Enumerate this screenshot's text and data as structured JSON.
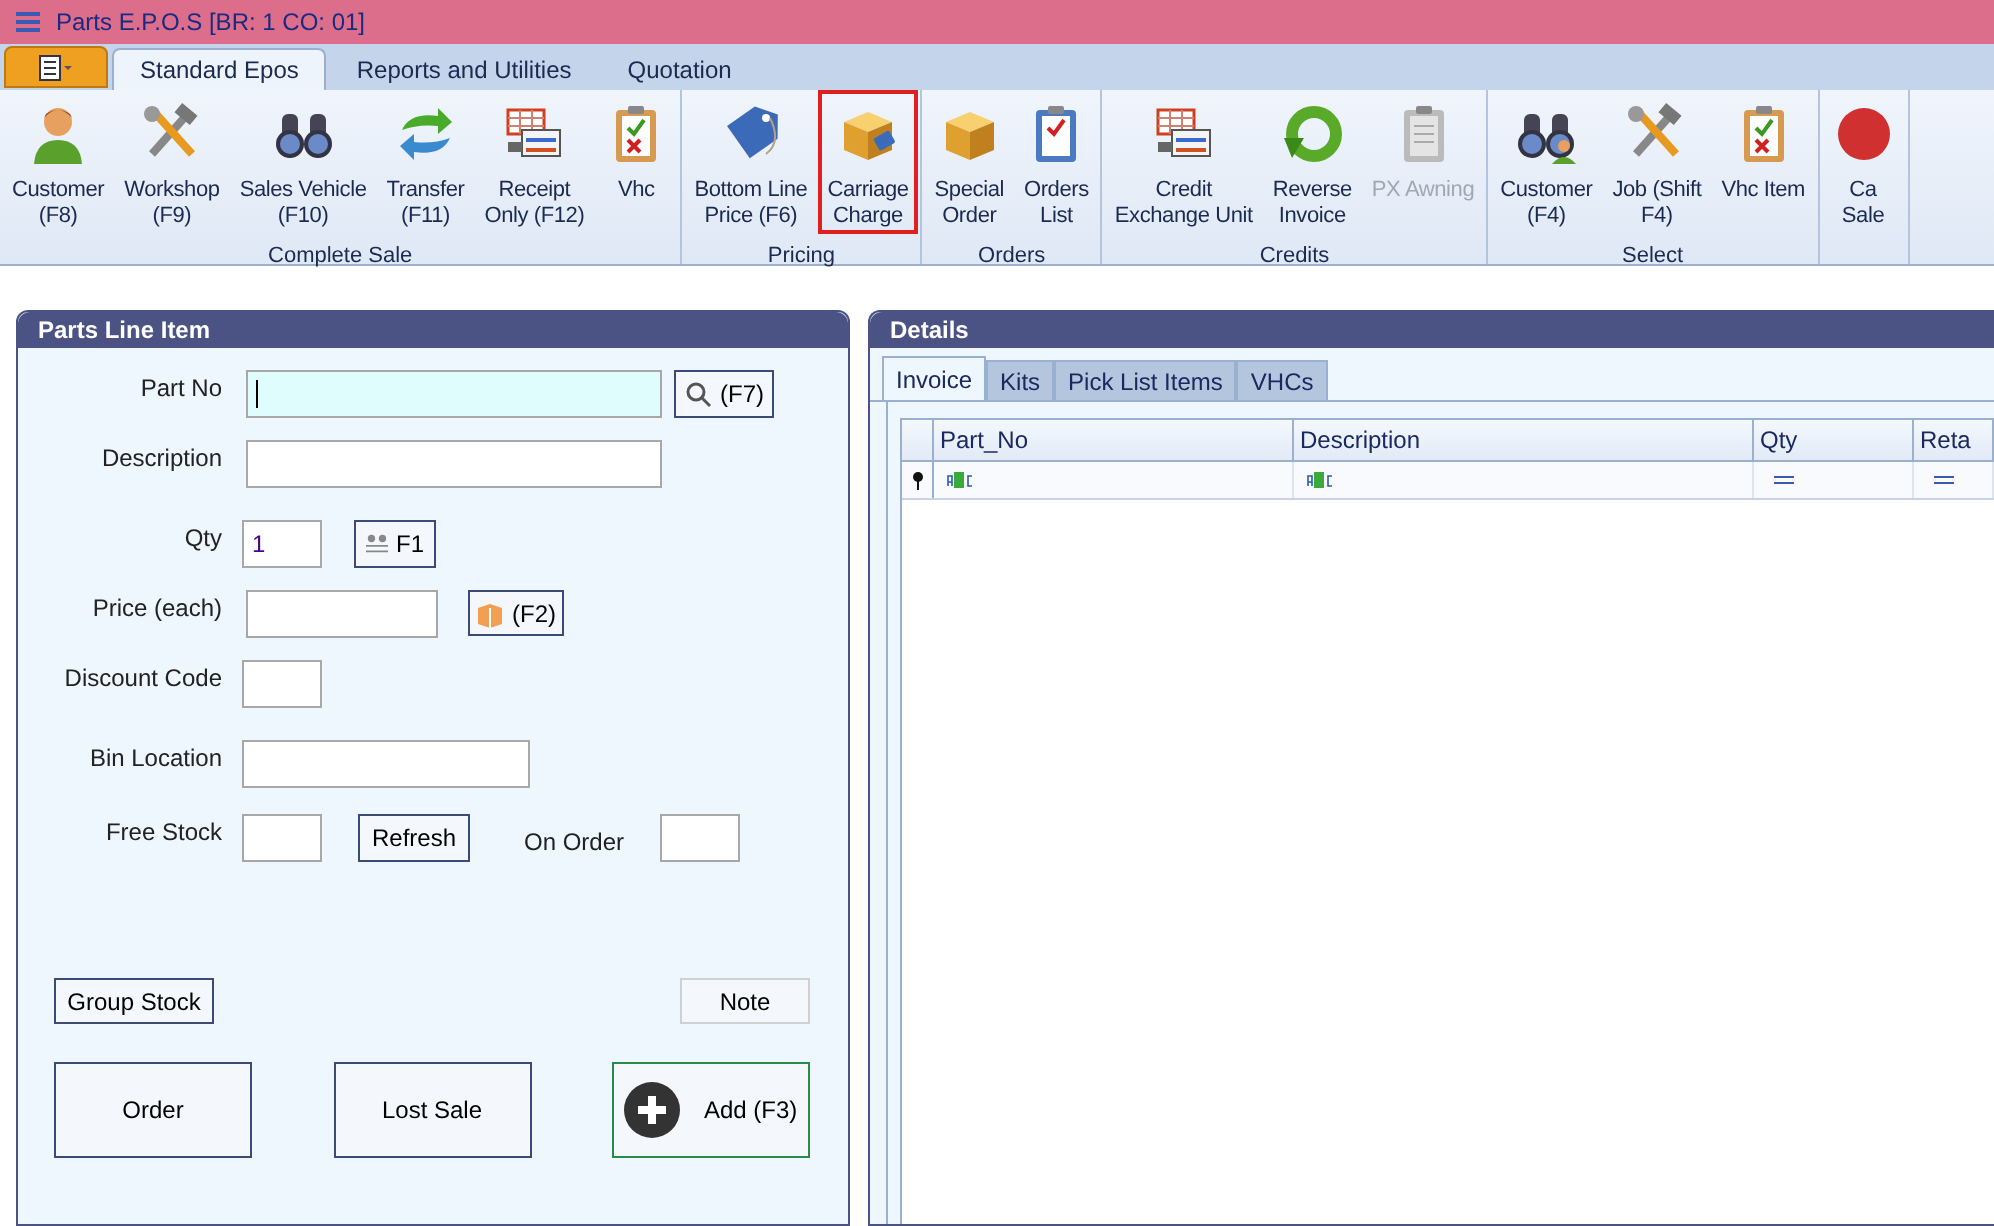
{
  "window": {
    "title": "Parts E.P.O.S [BR: 1 CO: 01]"
  },
  "ribbon": {
    "tabs": [
      {
        "label": "Standard Epos",
        "selected": true
      },
      {
        "label": "Reports and Utilities",
        "selected": false
      },
      {
        "label": "Quotation",
        "selected": false
      }
    ],
    "groups": [
      {
        "label": "Complete Sale",
        "items": [
          {
            "lines": [
              "Customer",
              "(F8)"
            ],
            "disabled": false,
            "highlighted": false
          },
          {
            "lines": [
              "Workshop",
              "(F9)"
            ],
            "disabled": false,
            "highlighted": false
          },
          {
            "lines": [
              "Sales Vehicle",
              "(F10)"
            ],
            "disabled": false,
            "highlighted": false
          },
          {
            "lines": [
              "Transfer",
              "(F11)"
            ],
            "disabled": false,
            "highlighted": false
          },
          {
            "lines": [
              "Receipt",
              "Only (F12)"
            ],
            "disabled": false,
            "highlighted": false
          },
          {
            "lines": [
              "Vhc"
            ],
            "disabled": false,
            "highlighted": false
          }
        ]
      },
      {
        "label": "Pricing",
        "items": [
          {
            "lines": [
              "Bottom Line",
              "Price (F6)"
            ],
            "disabled": false,
            "highlighted": false
          },
          {
            "lines": [
              "Carriage",
              "Charge"
            ],
            "disabled": false,
            "highlighted": true
          }
        ]
      },
      {
        "label": "Orders",
        "items": [
          {
            "lines": [
              "Special",
              "Order"
            ],
            "disabled": false,
            "highlighted": false
          },
          {
            "lines": [
              "Orders",
              "List"
            ],
            "disabled": false,
            "highlighted": false
          }
        ]
      },
      {
        "label": "Credits",
        "items": [
          {
            "lines": [
              "Credit",
              "Exchange Unit"
            ],
            "disabled": false,
            "highlighted": false
          },
          {
            "lines": [
              "Reverse",
              "Invoice"
            ],
            "disabled": false,
            "highlighted": false
          },
          {
            "lines": [
              "PX Awning"
            ],
            "disabled": true,
            "highlighted": false
          }
        ]
      },
      {
        "label": "Select",
        "items": [
          {
            "lines": [
              "Customer",
              "(F4)"
            ],
            "disabled": false,
            "highlighted": false
          },
          {
            "lines": [
              "Job (Shift",
              "F4)"
            ],
            "disabled": false,
            "highlighted": false
          },
          {
            "lines": [
              "Vhc Item"
            ],
            "disabled": false,
            "highlighted": false
          }
        ]
      },
      {
        "items": [
          {
            "lines": [
              "Ca",
              "Sale"
            ],
            "disabled": false,
            "highlighted": false
          }
        ]
      }
    ]
  },
  "parts_line_item": {
    "title": "Parts Line Item",
    "part_no": {
      "label": "Part No",
      "focused": true,
      "button": "(F7)"
    },
    "description": {
      "label": "Description"
    },
    "qty": {
      "label": "Qty",
      "value": "1",
      "button": "F1"
    },
    "price": {
      "label": "Price (each)",
      "button": "(F2)"
    },
    "discount_code": {
      "label": "Discount Code"
    },
    "bin_location": {
      "label": "Bin Location"
    },
    "free_stock": {
      "label": "Free Stock",
      "button": "Refresh"
    },
    "on_order": {
      "label": "On Order"
    },
    "group_stock_button": "Group Stock",
    "note_button": "Note",
    "order_button": "Order",
    "lost_sale_button": "Lost Sale",
    "add_button": "Add (F3)"
  },
  "details": {
    "title": "Details",
    "tabs": [
      {
        "label": "Invoice",
        "selected": true
      },
      {
        "label": "Kits",
        "selected": false
      },
      {
        "label": "Pick List Items",
        "selected": false
      },
      {
        "label": "VHCs",
        "selected": false
      }
    ],
    "table": {
      "columns": [
        "Part_No",
        "Description",
        "Qty",
        "Reta"
      ]
    }
  }
}
